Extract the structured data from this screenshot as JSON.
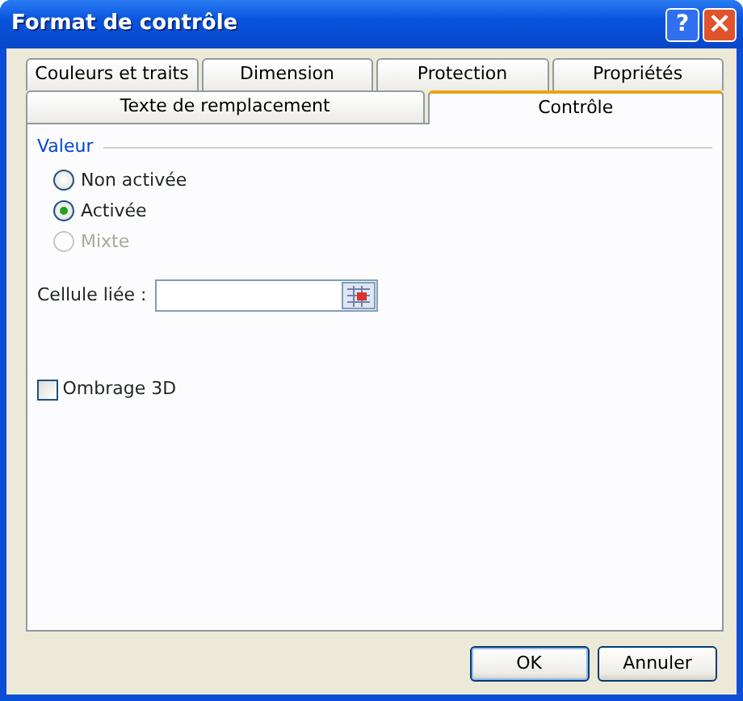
{
  "window": {
    "title": "Format de contrôle",
    "help_button": "?",
    "close_button": "×"
  },
  "tab_rows": [
    {
      "tabs": [
        {
          "label": "Couleurs et traits",
          "selected": false
        },
        {
          "label": "Dimension",
          "selected": false
        },
        {
          "label": "Protection",
          "selected": false
        },
        {
          "label": "Propriétés",
          "selected": false
        }
      ]
    },
    {
      "tabs": [
        {
          "label": "Texte de remplacement",
          "selected": false
        },
        {
          "label": "Contrôle",
          "selected": true
        }
      ]
    }
  ],
  "value_group": {
    "title": "Valeur",
    "options": [
      {
        "label": "Non activée",
        "selected": false,
        "disabled": false
      },
      {
        "label": "Activée",
        "selected": true,
        "disabled": false
      },
      {
        "label": "Mixte",
        "selected": false,
        "disabled": true
      }
    ]
  },
  "linked_cell": {
    "label": "Cellule liée :"
  },
  "shading_3d": {
    "label": "Ombrage 3D",
    "checked": false
  },
  "buttons": [
    "OK",
    "Annuler"
  ]
}
